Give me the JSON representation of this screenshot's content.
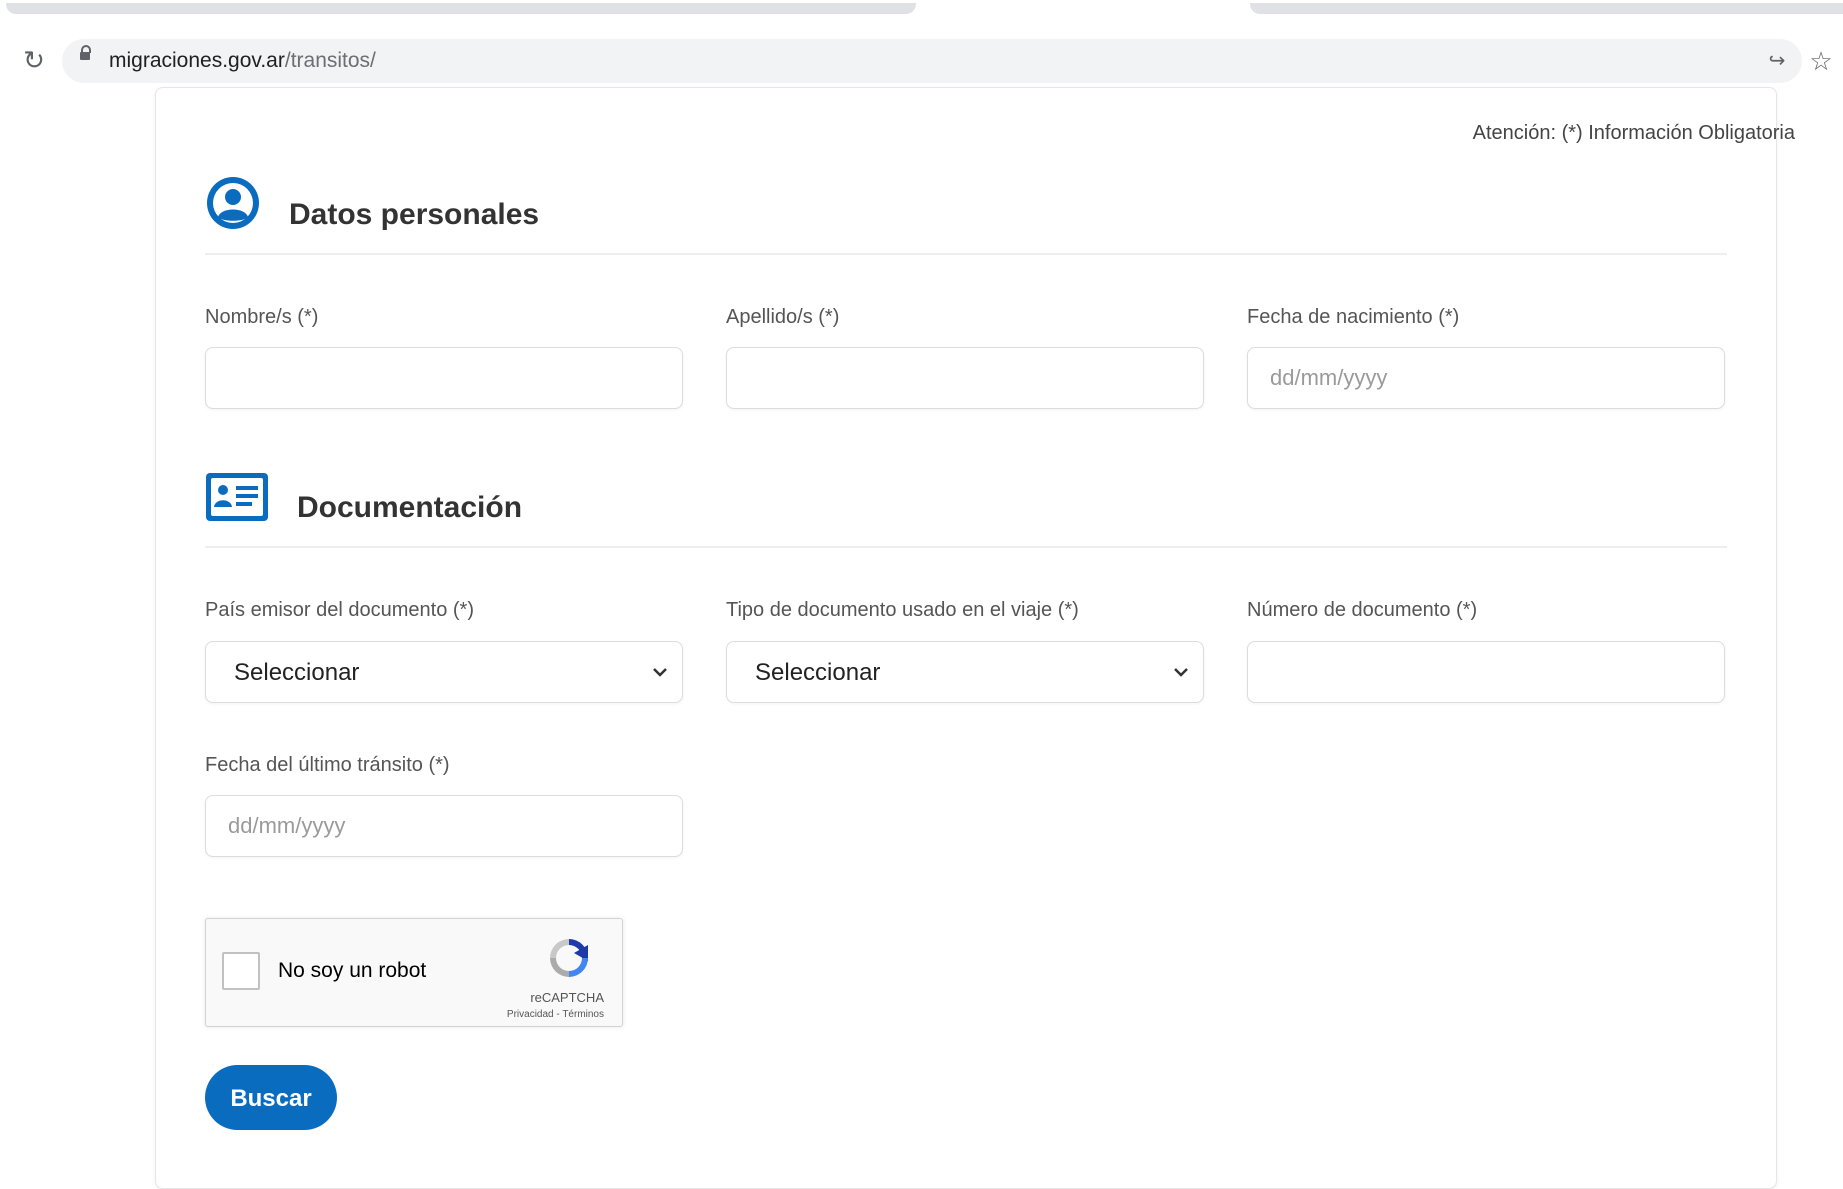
{
  "browser": {
    "url_host": "migraciones.gov.ar",
    "url_path": "/transitos/",
    "icons": [
      "reload-icon",
      "lock-icon",
      "share-icon",
      "star-icon"
    ]
  },
  "form": {
    "attention": "Atención: (*) Información Obligatoria",
    "personal": {
      "title": "Datos personales",
      "icon": "user-circle-icon",
      "nombre_label": "Nombre/s (*)",
      "nombre_value": "",
      "apellido_label": "Apellido/s (*)",
      "apellido_value": "",
      "nacimiento_label": "Fecha de nacimiento (*)",
      "nacimiento_placeholder": "dd/mm/yyyy"
    },
    "documentacion": {
      "title": "Documentación",
      "icon": "id-card-icon",
      "pais_label": "País emisor del documento (*)",
      "pais_value": "Seleccionar",
      "tipo_label": "Tipo de documento usado en el viaje (*)",
      "tipo_value": "Seleccionar",
      "numero_label": "Número de documento (*)",
      "numero_value": "",
      "transito_label": "Fecha del último tránsito (*)",
      "transito_placeholder": "dd/mm/yyyy"
    },
    "recaptcha": {
      "label": "No soy un robot",
      "brand": "reCAPTCHA",
      "links": "Privacidad - Términos",
      "checked": false
    },
    "submit_label": "Buscar",
    "accent_color": "#0a6cbf"
  }
}
